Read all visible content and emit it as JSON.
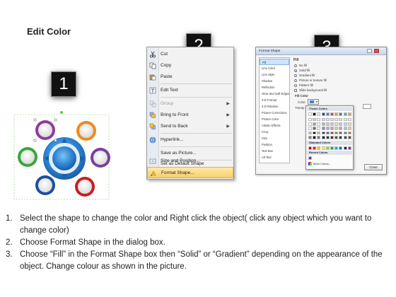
{
  "title": "Edit Color",
  "steps": [
    "1",
    "2",
    "3"
  ],
  "context_menu": {
    "items": [
      {
        "label": "Cut",
        "icon": "scissors-icon",
        "state": "normal",
        "submenu": false
      },
      {
        "label": "Copy",
        "icon": "copy-icon",
        "state": "normal",
        "submenu": false
      },
      {
        "label": "Paste",
        "icon": "paste-icon",
        "state": "normal",
        "submenu": false
      },
      {
        "label": "Edit Text",
        "icon": "edit-text-icon",
        "state": "normal",
        "submenu": false
      },
      {
        "label": "Group",
        "icon": "group-icon",
        "state": "disabled",
        "submenu": true
      },
      {
        "label": "Bring to Front",
        "icon": "bring-front-icon",
        "state": "normal",
        "submenu": true
      },
      {
        "label": "Send to Back",
        "icon": "send-back-icon",
        "state": "normal",
        "submenu": true
      },
      {
        "label": "Hyperlink...",
        "icon": "hyperlink-icon",
        "state": "normal",
        "submenu": false
      },
      {
        "label": "Save as Picture...",
        "icon": "",
        "state": "normal",
        "submenu": false
      },
      {
        "label": "Set as Default Shape",
        "icon": "",
        "state": "normal",
        "submenu": false
      },
      {
        "label": "Size and Position...",
        "icon": "size-position-icon",
        "state": "normal",
        "submenu": false
      },
      {
        "label": "Format Shape...",
        "icon": "format-shape-icon",
        "state": "selected",
        "submenu": false
      }
    ]
  },
  "format_dialog": {
    "title": "Format Shape",
    "categories": [
      "Fill",
      "Line Color",
      "Line Style",
      "Shadow",
      "Reflection",
      "Glow and Soft Edges",
      "3-D Format",
      "3-D Rotation",
      "Picture Corrections",
      "Picture Color",
      "Artistic Effects",
      "Crop",
      "Size",
      "Position",
      "Text Box",
      "Alt Text"
    ],
    "selected_category": "Fill",
    "section_title": "Fill",
    "fill_options": [
      {
        "label": "No fill",
        "type": "radio",
        "checked": false
      },
      {
        "label": "Solid fill",
        "type": "radio",
        "checked": true
      },
      {
        "label": "Gradient fill",
        "type": "radio",
        "checked": false
      },
      {
        "label": "Picture or texture fill",
        "type": "radio",
        "checked": false
      },
      {
        "label": "Pattern fill",
        "type": "radio",
        "checked": false
      },
      {
        "label": "Slide background fill",
        "type": "checkbox",
        "checked": false
      }
    ],
    "fill_color_label": "Fill Color",
    "color_label": "Color:",
    "transparency_label": "Transp",
    "close_label": "Close",
    "palette": {
      "theme_header": "Theme Colors",
      "standard_header": "Standard Colors",
      "recent_header": "Recent Colors",
      "more_label": "More Colors...",
      "theme_top_row": [
        "#ffffff",
        "#000000",
        "#eeece1",
        "#1f497d",
        "#4f81bd",
        "#c0504d",
        "#9bbb59",
        "#8064a2",
        "#4bacc6",
        "#f79646"
      ],
      "standard": [
        "#c00000",
        "#ff0000",
        "#ffc000",
        "#ffff00",
        "#92d050",
        "#00b050",
        "#00b0f0",
        "#0070c0",
        "#002060",
        "#7030a0"
      ],
      "recent": [
        "#7030a0"
      ]
    }
  },
  "instructions": [
    {
      "num": "1.",
      "text": "Select the shape to change the color and Right click the object( click any object which you want to change color)"
    },
    {
      "num": "2.",
      "text": "Choose Format Shape in the dialog box."
    },
    {
      "num": "3.",
      "text": "Choose “Fill” in the Format Shape box then “Solid” or “Gradient” depending on the appearance of the object. Change colour as shown in the picture."
    }
  ]
}
